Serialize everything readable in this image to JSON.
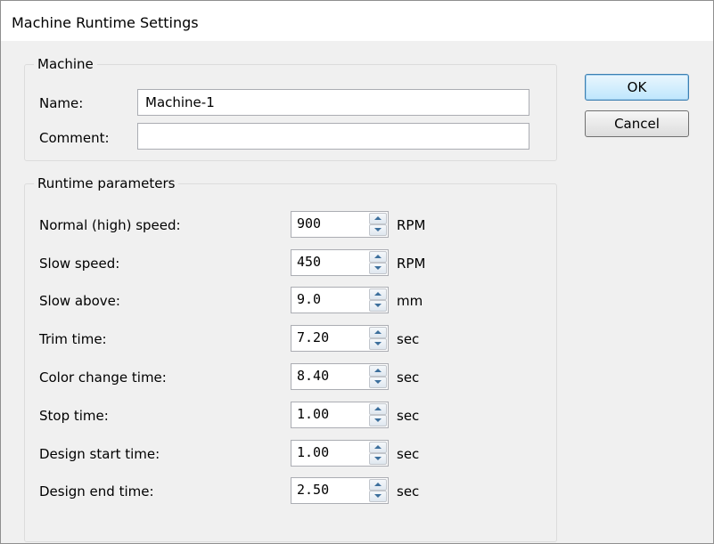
{
  "window": {
    "title": "Machine Runtime Settings"
  },
  "machine": {
    "legend": "Machine",
    "name_label": "Name:",
    "name_value": "Machine-1",
    "comment_label": "Comment:",
    "comment_value": ""
  },
  "runtime": {
    "legend": "Runtime parameters",
    "params": [
      {
        "label": "Normal (high) speed:",
        "value": "900",
        "unit": "RPM"
      },
      {
        "label": "Slow speed:",
        "value": "450",
        "unit": "RPM"
      },
      {
        "label": "Slow above:",
        "value": "9.0",
        "unit": "mm"
      },
      {
        "label": "Trim time:",
        "value": "7.20",
        "unit": "sec"
      },
      {
        "label": "Color change time:",
        "value": "8.40",
        "unit": "sec"
      },
      {
        "label": "Stop time:",
        "value": "1.00",
        "unit": "sec"
      },
      {
        "label": "Design start time:",
        "value": "1.00",
        "unit": "sec"
      },
      {
        "label": "Design end time:",
        "value": "2.50",
        "unit": "sec"
      }
    ]
  },
  "buttons": {
    "ok": "OK",
    "cancel": "Cancel"
  }
}
